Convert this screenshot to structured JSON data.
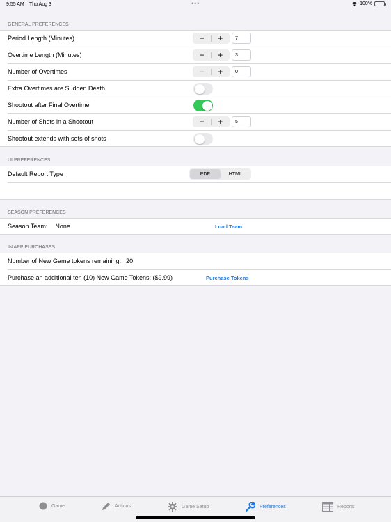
{
  "status_bar": {
    "time": "9:55 AM",
    "date": "Thu Aug 3",
    "dots": "•••",
    "battery": "100%"
  },
  "general": {
    "header": "General Preferences",
    "period_length": {
      "label": "Period Length (Minutes)",
      "value": "7"
    },
    "overtime_length": {
      "label": "Overtime Length (Minutes)",
      "value": "3"
    },
    "number_of_overtimes": {
      "label": "Number of Overtimes",
      "value": "0"
    },
    "sudden_death": {
      "label": "Extra Overtimes are Sudden Death",
      "on": false
    },
    "shootout_after": {
      "label": "Shootout after Final Overtime",
      "on": true
    },
    "shots_in_shootout": {
      "label": "Number of Shots in a Shootout",
      "value": "5"
    },
    "shootout_sets": {
      "label": "Shootout extends with sets of shots",
      "on": false
    },
    "minus": "−",
    "plus": "+"
  },
  "ui": {
    "header": "UI Preferences",
    "report_type": {
      "label": "Default Report Type",
      "options": [
        "PDF",
        "HTML"
      ],
      "selected": "PDF"
    }
  },
  "season": {
    "header": "Season Preferences",
    "team_label": "Season Team:",
    "team_value": "None",
    "load_team": "Load Team"
  },
  "iap": {
    "header": "In App Purchases",
    "tokens_label": "Number of New Game tokens remaining:",
    "tokens_value": "20",
    "purchase_label": "Purchase an additional ten (10) New Game Tokens: ($9.99)",
    "purchase_button": "Purchase Tokens"
  },
  "tabs": [
    {
      "label": "Game",
      "icon": "circle-icon"
    },
    {
      "label": "Actions",
      "icon": "pencil-icon"
    },
    {
      "label": "Game Setup",
      "icon": "gear-icon"
    },
    {
      "label": "Preferences",
      "icon": "wrench-icon",
      "active": true
    },
    {
      "label": "Reports",
      "icon": "table-icon"
    }
  ],
  "colors": {
    "accent": "#1f7ae0",
    "toggle_on": "#34c759",
    "background": "#f2f2f7"
  }
}
